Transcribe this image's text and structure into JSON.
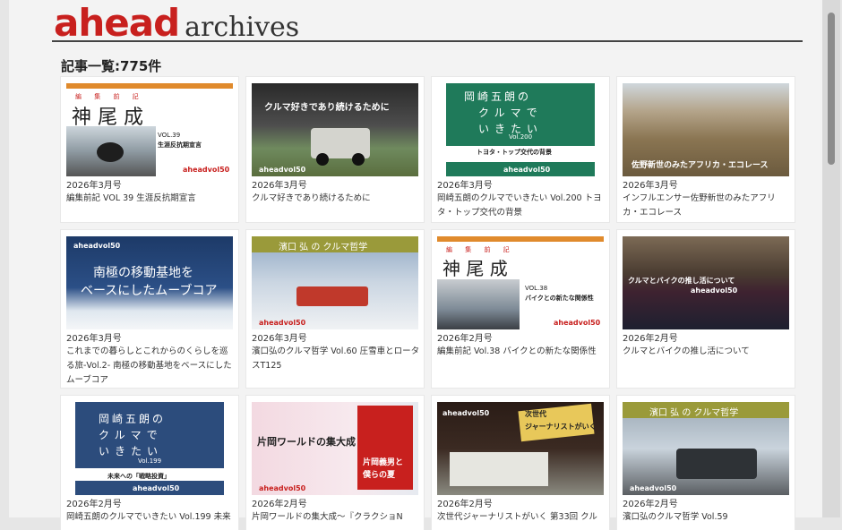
{
  "header": {
    "logo_main": "ahead",
    "logo_sub": "archives",
    "count_label": "記事一覧:775件"
  },
  "cards": [
    {
      "date": "2026年3月号",
      "title": "編集前記 VOL 39 生涯反抗期宣言",
      "thumb": {
        "headline": "神 尾 成",
        "subhead": "編 集 前 記",
        "sub2": "VOL.39",
        "sub3": "生涯反抗期宣言",
        "brand": "aheadvol50"
      }
    },
    {
      "date": "2026年3月号",
      "title": "クルマ好きであり続けるために",
      "thumb": {
        "headline": "クルマ好きであり続けるために",
        "brand": "aheadvol50"
      }
    },
    {
      "date": "2026年3月号",
      "title": "岡崎五朗のクルマでいきたい Vol.200 トヨタ・トップ交代の背景",
      "thumb": {
        "headline": "岡崎五朗の",
        "sub2": "クルマで",
        "sub3": "いきたい",
        "vol": "Vol.200",
        "subtitle": "トヨタ・トップ交代の背景",
        "brand": "aheadvol50"
      }
    },
    {
      "date": "2026年3月号",
      "title": "インフルエンサー佐野新世のみたアフリカ・エコレース",
      "thumb": {
        "headline": "佐野新世のみたアフリカ・エコレース"
      }
    },
    {
      "date": "2026年3月号",
      "title": "これまでの暮らしとこれからのくらしを巡る旅-Vol.2- 南極の移動基地をベースにしたムーブコア",
      "thumb": {
        "headline": "南極の移動基地を",
        "sub2": "ベースにしたムーブコア",
        "brand": "aheadvol50"
      }
    },
    {
      "date": "2026年3月号",
      "title": "濱口弘のクルマ哲学 Vol.60 圧雪車とロータスT125",
      "thumb": {
        "headline": "濱口 弘 の クルマ哲学",
        "brand": "aheadvol50"
      }
    },
    {
      "date": "2026年2月号",
      "title": "編集前記 Vol.38 バイクとの新たな関係性",
      "thumb": {
        "headline": "神 尾 成",
        "subhead": "編 集 前 記",
        "sub2": "VOL.38",
        "sub3": "バイクとの新たな関係性",
        "brand": "aheadvol50"
      }
    },
    {
      "date": "2026年2月号",
      "title": "クルマとバイクの推し活について",
      "thumb": {
        "headline": "クルマとバイクの推し活について",
        "brand": "aheadvol50"
      }
    },
    {
      "date": "2026年2月号",
      "title": "岡崎五朗のクルマでいきたい Vol.199 未来",
      "thumb": {
        "headline": "岡崎五朗の",
        "sub2": "クルマで",
        "sub3": "いきたい",
        "vol": "Vol.199",
        "subtitle": "未来への「戦略投資」",
        "brand": "aheadvol50"
      }
    },
    {
      "date": "2026年2月号",
      "title": "片岡ワールドの集大成〜『クラクショN",
      "thumb": {
        "headline": "片岡ワールドの集大成",
        "sub2": "片岡義男と",
        "sub3": "僕らの夏",
        "brand": "aheadvol50"
      }
    },
    {
      "date": "2026年2月号",
      "title": "次世代ジャーナリストがいく 第33回 クル",
      "thumb": {
        "headline": "次世代",
        "sub2": "ジャーナリストがいく",
        "brand": "aheadvol50"
      }
    },
    {
      "date": "2026年2月号",
      "title": "濱口弘のクルマ哲学 Vol.59",
      "thumb": {
        "headline": "濱口 弘 の クルマ哲学",
        "brand": "aheadvol50"
      }
    }
  ]
}
